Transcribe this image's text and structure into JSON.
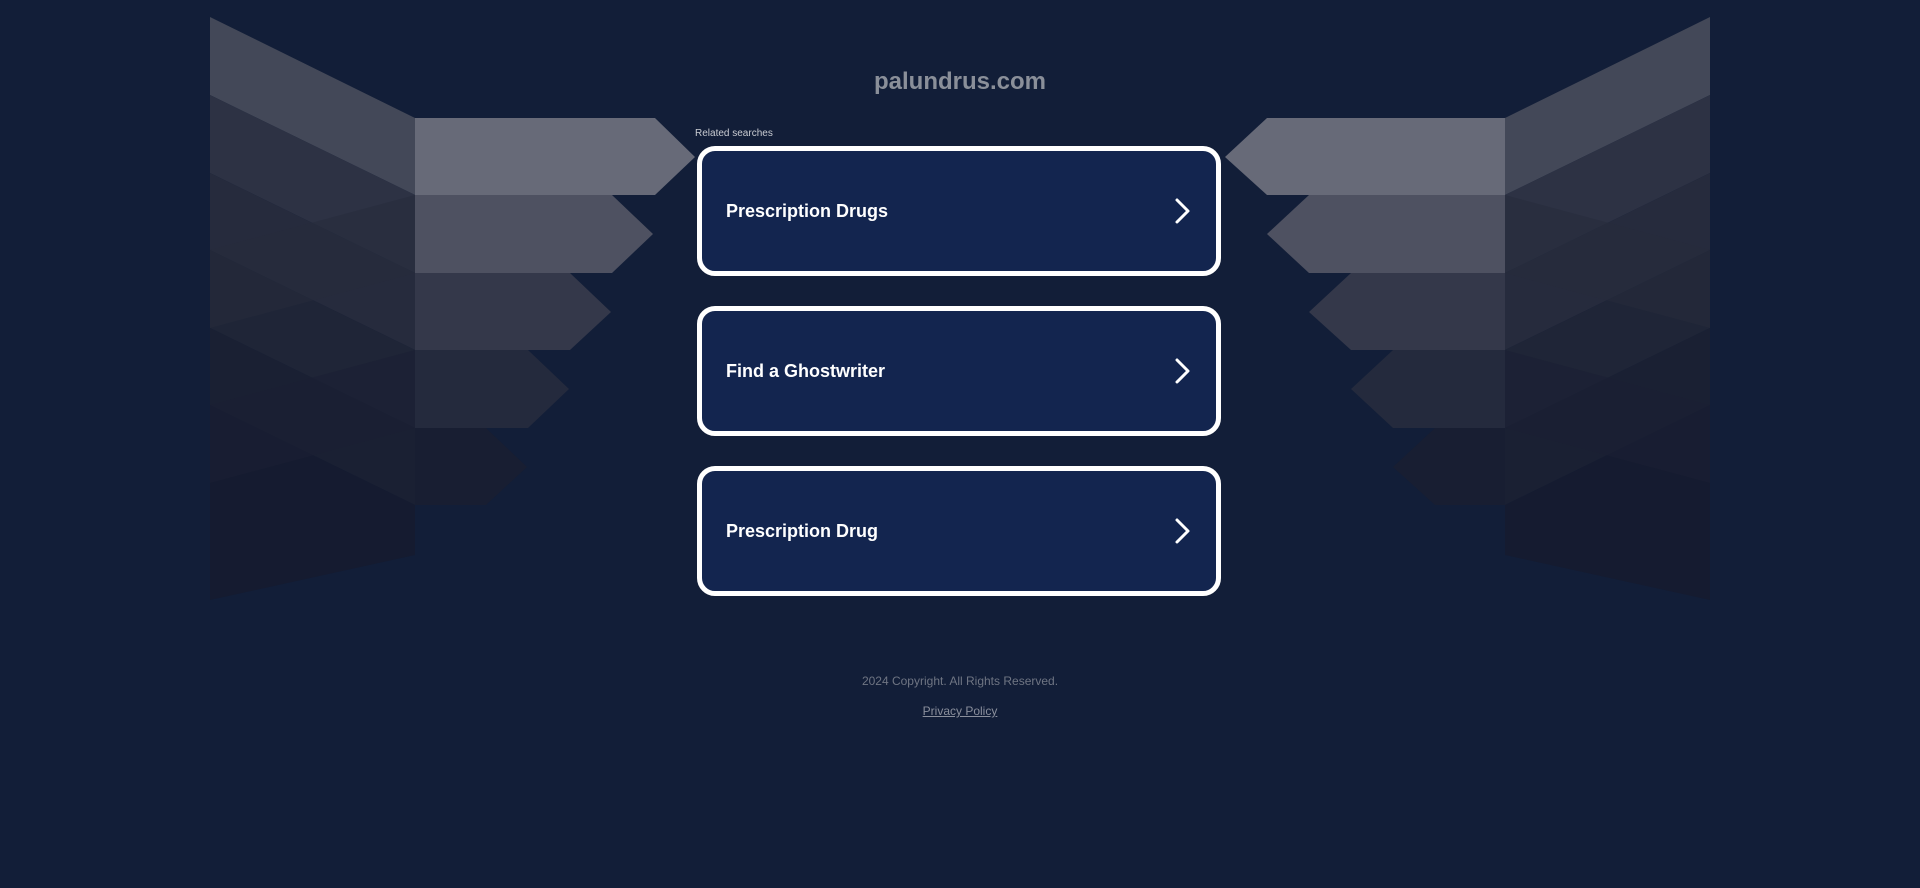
{
  "site": {
    "domain": "palundrus.com"
  },
  "related": {
    "label": "Related searches",
    "items": [
      {
        "label": "Prescription Drugs",
        "icon": "chevron-right-icon"
      },
      {
        "label": "Find a Ghostwriter",
        "icon": "chevron-right-icon"
      },
      {
        "label": "Prescription Drug",
        "icon": "chevron-right-icon"
      }
    ]
  },
  "footer": {
    "copyright": "2024 Copyright. All Rights Reserved.",
    "privacy_link": "Privacy Policy"
  },
  "colors": {
    "background": "#121e38",
    "card_fill": "#13254f",
    "card_border": "#ffffff"
  }
}
